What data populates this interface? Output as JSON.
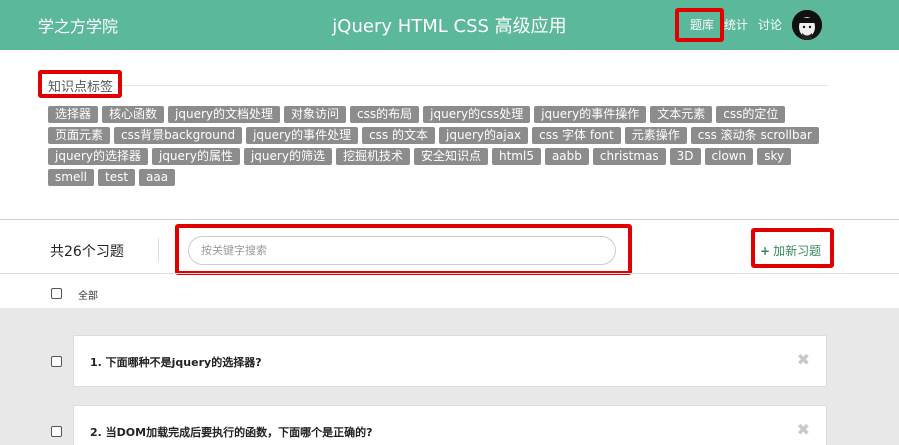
{
  "header": {
    "brand": "学之方学院",
    "title": "jQuery HTML CSS 高级应用",
    "nav": [
      "题库",
      "统计",
      "讨论"
    ],
    "bg_color": "#5bb89a"
  },
  "tags_section": {
    "title": "知识点标签",
    "tags": [
      "选择器",
      "核心函数",
      "jquery的文档处理",
      "对象访问",
      "css的布局",
      "jquery的css处理",
      "jquery的事件操作",
      "文本元素",
      "css的定位",
      "页面元素",
      "css背景background",
      "jquery的事件处理",
      "css 的文本",
      "jquery的ajax",
      "css 字体 font",
      "元素操作",
      "css 滚动条 scrollbar",
      "jquery的选择器",
      "jquery的属性",
      "jquery的筛选",
      "挖掘机技术",
      "安全知识点",
      "html5",
      "aabb",
      "christmas",
      "3D",
      "clown",
      "sky",
      "smell",
      "test",
      "aaa"
    ]
  },
  "toolbar": {
    "count_label": "共26个习题",
    "search_placeholder": "按关键字搜索",
    "add_label": "加新习题",
    "select_all_label": "全部"
  },
  "questions": [
    {
      "text": "1. 下面哪种不是jquery的选择器?"
    },
    {
      "text": "2. 当DOM加载完成后要执行的函数，下面哪个是正确的?"
    }
  ],
  "icons": {
    "add": "plus-icon",
    "delete": "close-icon",
    "avatar": "user-avatar"
  },
  "highlight_color": "#e00000"
}
